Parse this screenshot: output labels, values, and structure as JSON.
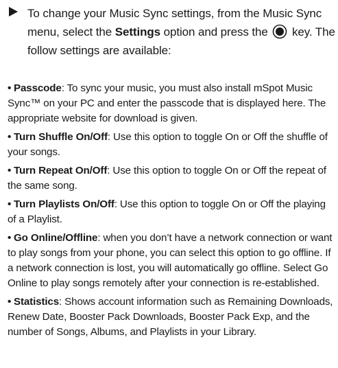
{
  "intro": {
    "before_bold": "To change your Music Sync settings, from the Music Sync menu, select the ",
    "bold": "Settings",
    "after_bold": " option and press the ",
    "after_key": " key. The follow settings are available:"
  },
  "settings": [
    {
      "term": "Passcode",
      "description": ": To sync your music, you must also install mSpot Music Sync™ on your PC and enter the passcode that is displayed here. The appropriate website for download is given."
    },
    {
      "term": "Turn Shuffle On/Off",
      "description": ": Use this option to toggle On or Off the shuffle of your songs."
    },
    {
      "term": "Turn Repeat On/Off",
      "description": ": Use this option to toggle On or Off the repeat of the same song."
    },
    {
      "term": "Turn Playlists On/Off",
      "description": ": Use this option to toggle On or Off the playing of a Playlist."
    },
    {
      "term": "Go Online/Offline",
      "description": ": when you don’t have a network connection or want to play songs from your phone, you can select this option to go offline. If a network connection is lost, you will automatically go offline. Select Go Online to play songs remotely after your connection is re-established."
    },
    {
      "term": "Statistics",
      "description": ": Shows account information such as Remaining Downloads, Renew Date, Booster Pack Downloads, Booster Pack Exp, and the number of Songs, Albums, and Playlists in your Library."
    }
  ],
  "icons": {
    "intro_marker": "right-triangle-arrow-icon",
    "select_key": "ok-key-icon"
  }
}
